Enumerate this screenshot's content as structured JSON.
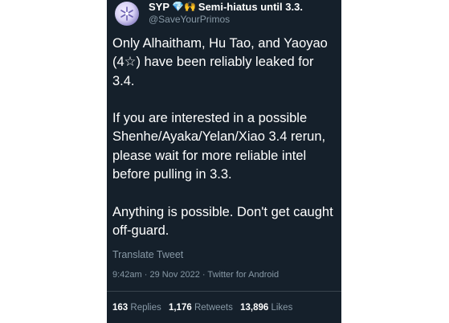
{
  "author": {
    "display_name": "SYP",
    "name_emoji": "💎🙌",
    "status_text": "Semi-hiatus until 3.3.",
    "handle": "@SaveYourPrimos",
    "avatar_icon": "snowflake-icon"
  },
  "tweet": {
    "text": "Only Alhaitham, Hu Tao, and Yaoyao (4☆) have been reliably leaked for 3.4.\n\nIf you are interested in a possible Shenhe/Ayaka/Yelan/Xiao 3.4 rerun, please wait for more reliable intel before pulling in 3.3.\n\nAnything is possible. Don't get caught off-guard.",
    "translate_label": "Translate Tweet",
    "meta": "9:42am · 29 Nov 2022 · Twitter for Android"
  },
  "stats": {
    "replies_count": "163",
    "replies_label": "Replies",
    "retweets_count": "1,176",
    "retweets_label": "Retweets",
    "likes_count": "13,896",
    "likes_label": "Likes"
  },
  "colors": {
    "background": "#15202b",
    "secondary_text": "#8899a6",
    "divider": "#38444d"
  }
}
